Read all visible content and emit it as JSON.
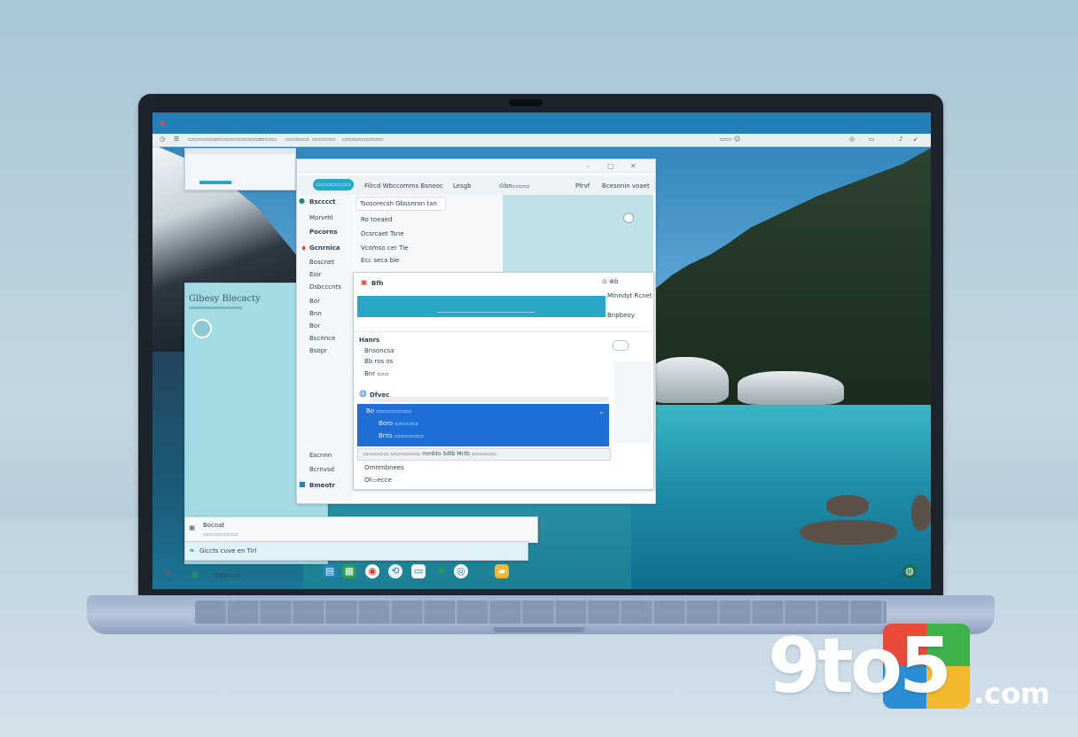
{
  "colors": {
    "accent": "#2380b8",
    "selection": "#1f6fd6",
    "teal": "#2aa6c6"
  },
  "menubar": {
    "items": [
      "◷",
      "☰",
      "▭▭▭▭▭",
      "▭▭▭▭▭▭▭▭",
      "▭▭▭",
      "▭▭▭▭",
      "▭▭▭▭",
      "▭▭▭▭▭▭▭"
    ],
    "right": [
      "▭▭",
      "☺",
      "◎",
      "▭",
      "♪",
      "↙"
    ]
  },
  "left_window": {
    "heading": "Glbesy Blecacty",
    "footer_name": "Bocoat",
    "footer_sub": "▭▭▭▭▭▭",
    "bottom_text": "Giccts cuve en Tirl"
  },
  "main_window": {
    "toolbar": {
      "pill": "▭▭▭▭▭▭▭",
      "tab1": "Filrcd Wbccomms Bsneoc",
      "tab2": "Lesgb",
      "tab3": "⊙bn▭▭▭",
      "tab4": "Pfrvf",
      "tab5": "Bcesonin voaet"
    },
    "sidebar": [
      "Bscccct",
      "Morvrhl",
      "Pocorns",
      "Gcnrnica",
      "Boscnet",
      "Eoir",
      "Dsbcccnts",
      "Bor",
      "Bnn",
      "Bor",
      "Bscnnce",
      "Bsopr",
      "Escnnn",
      "Bcrnvsd",
      "Bmeotr"
    ],
    "list": [
      "Tsosorecsh Gbssnron tan",
      "Ro toeaed",
      "Dcsrcaet Tsne",
      "Vcomso cer Tie",
      "Ecc seca ble"
    ]
  },
  "inner_window": {
    "title": "Bfh",
    "right_label": "⊙ ⊕ɓ",
    "right_sub1": "Mlnndyt Rcnet",
    "right_sub2": "Bnpbeoy",
    "rows": [
      "Hanrs",
      "Bnsoncsa",
      "Bb ros os",
      "Bnr ▭▭"
    ],
    "section": "Dfvec",
    "selected_rows": [
      "Bo ▭▭▭▭▭▭",
      "Boro ▭▭▭▭",
      "Bnts ▭▭▭▭▭"
    ],
    "status": "▭▭▭▭▭  ▭▭▭▭▭▭  mmbto Sdtb Mctb ▭▭▭▭▭",
    "footer_rows": [
      "Omnmbnees",
      "Of▭ecce"
    ]
  },
  "taskbar": {
    "label": "Gfhmcrs"
  },
  "watermark": {
    "brand": "9to5",
    "suffix": ".com"
  }
}
